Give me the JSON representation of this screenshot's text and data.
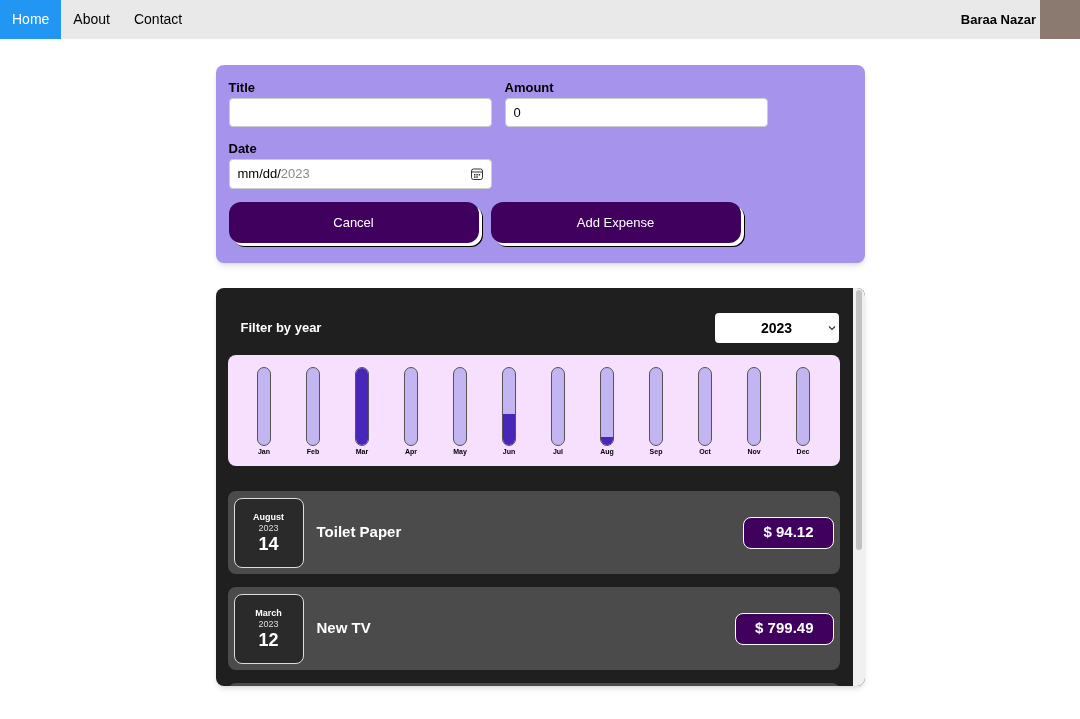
{
  "nav": {
    "links": [
      {
        "label": "Home",
        "selected": true
      },
      {
        "label": "About",
        "selected": false
      },
      {
        "label": "Contact",
        "selected": false
      }
    ],
    "user_name": "Baraa Nazar"
  },
  "form": {
    "fields": [
      {
        "label": "Title"
      },
      {
        "label": "Amount",
        "value": "0"
      }
    ],
    "date": {
      "label": "Date",
      "value_typed": "mm/dd/",
      "value_hint": "2023"
    },
    "buttons": [
      "Cancel",
      "Add Expense"
    ]
  },
  "expenses": {
    "filter_label": "Filter by year",
    "year": "2023",
    "months": [
      {
        "label": "Jan",
        "level": 0
      },
      {
        "label": "Feb",
        "level": 0
      },
      {
        "label": "Mar",
        "level": 1
      },
      {
        "label": "Apr",
        "level": 0
      },
      {
        "label": "May",
        "level": 0
      },
      {
        "label": "Jun",
        "level": 0.4
      },
      {
        "label": "Jul",
        "level": 0
      },
      {
        "label": "Aug",
        "level": 0.1
      },
      {
        "label": "Sep",
        "level": 0
      },
      {
        "label": "Oct",
        "level": 0
      },
      {
        "label": "Nov",
        "level": 0
      },
      {
        "label": "Dec",
        "level": 0
      }
    ],
    "items": [
      {
        "month": "August",
        "year": "2023",
        "day": "14",
        "title": "Toilet Paper",
        "amount": "$ 94.12"
      },
      {
        "month": "March",
        "year": "2023",
        "day": "12",
        "title": "New TV",
        "amount": "$ 799.49"
      }
    ]
  }
}
